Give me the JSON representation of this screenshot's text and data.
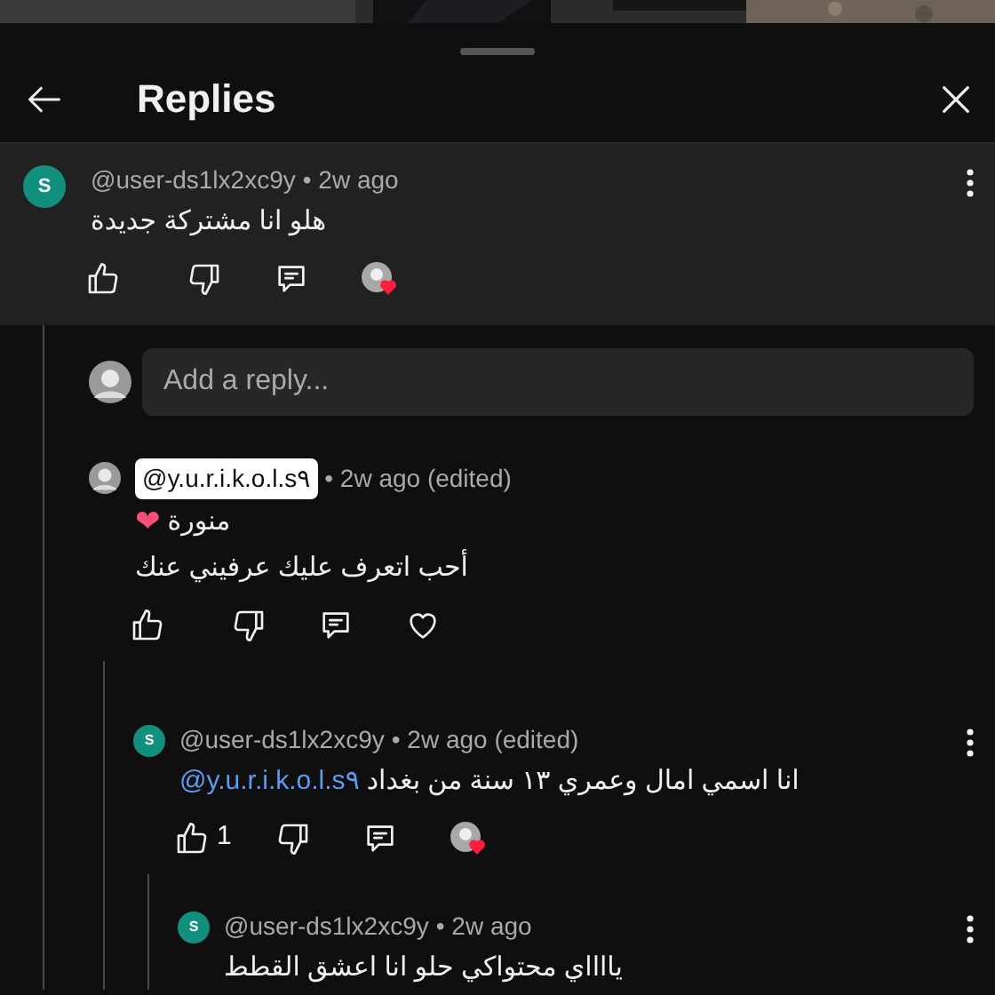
{
  "header": {
    "title": "Replies"
  },
  "parent_comment": {
    "avatar_letter": "S",
    "author": "@user-ds1lx2xc9y",
    "author_highlighted": false,
    "meta": "• 2w ago",
    "lines": [
      {
        "text": "هلو انا مشتركة جديدة"
      }
    ],
    "hearted": true,
    "has_menu": true
  },
  "reply_box": {
    "placeholder": "Add a reply..."
  },
  "replies": [
    {
      "author": "@y.u.r.i.k.o.l.s٩",
      "author_highlighted": true,
      "meta": "• 2w ago (edited)",
      "lines": [
        {
          "text": "منورة",
          "emoji": "❤"
        },
        {
          "text": "أحب اتعرف عليك عرفيني عنك"
        }
      ],
      "hearted": false,
      "has_menu": false,
      "children": [
        {
          "avatar_letter": "S",
          "author": "@user-ds1lx2xc9y",
          "author_highlighted": false,
          "meta": "• 2w ago (edited)",
          "lines": [
            {
              "mention": "@y.u.r.i.k.o.l.s٩",
              "text": "انا اسمي امال وعمري ١٣ سنة من بغداد"
            }
          ],
          "like_count": "1",
          "hearted": true,
          "has_menu": true,
          "children": [
            {
              "avatar_letter": "S",
              "author": "@user-ds1lx2xc9y",
              "author_highlighted": false,
              "meta": "• 2w ago",
              "lines": [
                {
                  "text": "يااااي محتواكي حلو انا اعشق القطط"
                }
              ],
              "has_menu": true
            }
          ]
        }
      ]
    }
  ]
}
